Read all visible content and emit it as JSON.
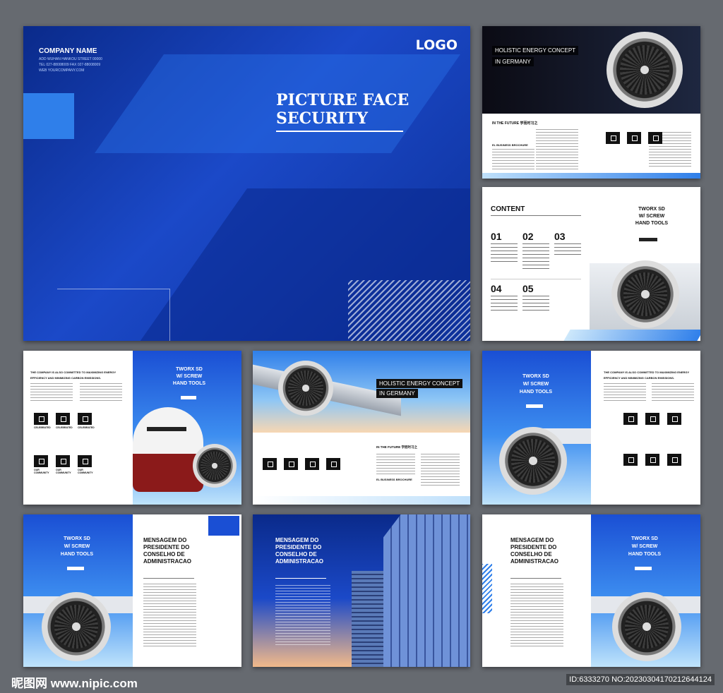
{
  "cover": {
    "company_name": "COMPANY NAME",
    "address": "ADD WUHAN HANKOU STREET 00000",
    "tel": "TEL 027-88008009 FAX 027-88008009",
    "web": "WEB YOURCOMPANY.COM",
    "logo": "LOGO",
    "title_line1": "PICTURE FACE",
    "title_line2": "SECURITY"
  },
  "page_holistic": {
    "tag1": "HOLISTIC ENERGY CONCEPT",
    "tag2": "IN GERMANY",
    "future": "IN THE FUTURE 学而时习之",
    "brochure": "EL BUSINESS BROCHURE"
  },
  "page_content": {
    "heading": "CONTENT",
    "numbers": [
      "01",
      "02",
      "03",
      "04",
      "05"
    ],
    "side_title1": "TWORX SD",
    "side_title2": "W/ SCREW",
    "side_title3": "HAND TOOLS"
  },
  "page_plane": {
    "headline1": "THE COMPANY IS ALSO COMMITTED TO MAXIMIZING ENERGY",
    "headline2": "EFFICIENCY AND MINIMIZING CARBON EMISSIONS.",
    "side_title1": "TWORX SD",
    "side_title2": "W/ SCREW",
    "side_title3": "HAND TOOLS",
    "icon_label1": "CELEBRATED",
    "icon_label2": "OUR COMMUNITY"
  },
  "page_holistic2": {
    "tag1": "HOLISTIC ENERGY CONCEPT",
    "tag2": "IN GERMANY",
    "future": "IN THE FUTURE 学而时习之",
    "brochure": "EL BUSINESS BROCHURE"
  },
  "page_engine_side": {
    "side_title1": "TWORX SD",
    "side_title2": "W/ SCREW",
    "side_title3": "HAND TOOLS",
    "headline1": "THE COMPANY IS ALSO COMMITTED TO MAXIMIZING ENERGY",
    "headline2": "EFFICIENCY AND MINIMIZING CARBON EMISSIONS."
  },
  "message_pages": {
    "msg_line1": "MENSAGEM DO",
    "msg_line2": "PRESIDENTE DO",
    "msg_line3": "CONSELHO DE",
    "msg_line4": "ADMINISTRACAO",
    "side_title1": "TWORX SD",
    "side_title2": "W/ SCREW",
    "side_title3": "HAND TOOLS"
  },
  "watermark": {
    "site": "昵图网 www.nipic.com",
    "id": "ID:6333270 NO:20230304170212644124"
  },
  "colors": {
    "background": "#666a70",
    "brand_blue": "#1a4fd4",
    "deep_blue": "#0a2a8a"
  }
}
